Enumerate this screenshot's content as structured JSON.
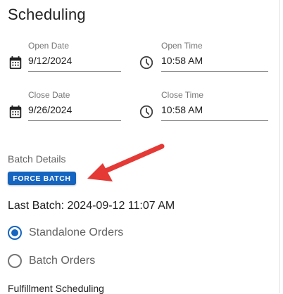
{
  "section": {
    "title": "Scheduling"
  },
  "open_date": {
    "label": "Open Date",
    "value": "9/12/2024",
    "icon": "calendar-icon"
  },
  "open_time": {
    "label": "Open Time",
    "value": "10:58 AM",
    "icon": "clock-icon"
  },
  "close_date": {
    "label": "Close Date",
    "value": "9/26/2024",
    "icon": "calendar-icon"
  },
  "close_time": {
    "label": "Close Time",
    "value": "10:58 AM",
    "icon": "clock-icon"
  },
  "batch": {
    "section_label": "Batch Details",
    "force_button": "FORCE BATCH",
    "last_batch": "Last Batch: 2024-09-12 11:07 AM"
  },
  "order_mode": {
    "options": [
      {
        "label": "Standalone Orders",
        "selected": true
      },
      {
        "label": "Batch Orders",
        "selected": false
      }
    ]
  },
  "fulfillment": {
    "label": "Fulfillment Scheduling"
  },
  "colors": {
    "accent": "#1565c0",
    "annotation_arrow": "#e53935"
  }
}
